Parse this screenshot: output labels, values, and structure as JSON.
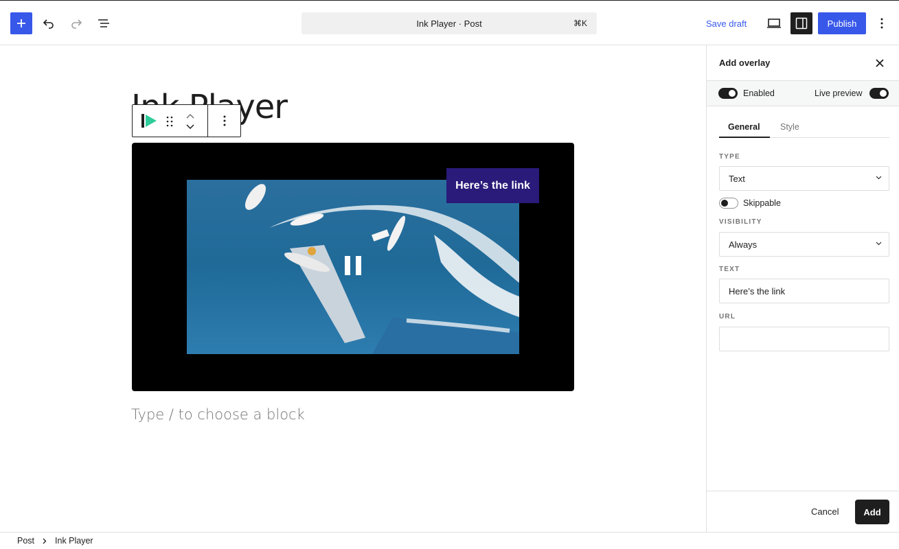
{
  "header": {
    "document_title": "Ink Player · Post",
    "shortcut": "⌘K",
    "save_draft": "Save draft",
    "publish": "Publish",
    "accent_color": "#3858e9"
  },
  "editor": {
    "post_title": "Ink Player",
    "placeholder": "Type / to choose a block",
    "video": {
      "overlay_text": "Here’s the link",
      "overlay_color": "#2a1a7a"
    }
  },
  "panel": {
    "title": "Add overlay",
    "enabled_label": "Enabled",
    "enabled": true,
    "live_preview_label": "Live preview",
    "live_preview": true,
    "tabs": [
      {
        "label": "General",
        "active": true
      },
      {
        "label": "Style",
        "active": false
      }
    ],
    "type_label": "TYPE",
    "type_value": "Text",
    "skippable_label": "Skippable",
    "skippable": false,
    "visibility_label": "VISIBILITY",
    "visibility_value": "Always",
    "text_label": "TEXT",
    "text_value": "Here’s the link",
    "url_label": "URL",
    "url_value": "",
    "cancel": "Cancel",
    "add": "Add"
  },
  "breadcrumb": {
    "items": [
      "Post",
      "Ink Player"
    ]
  },
  "icons": {
    "add": "plus-icon",
    "undo": "undo-icon",
    "redo": "redo-icon",
    "outline": "list-view-icon",
    "preview": "laptop-icon",
    "settings": "sidebar-icon",
    "more": "more-vertical-icon",
    "close": "close-icon",
    "block": "ink-player-icon",
    "drag": "drag-handle-icon",
    "pause": "pause-icon"
  }
}
